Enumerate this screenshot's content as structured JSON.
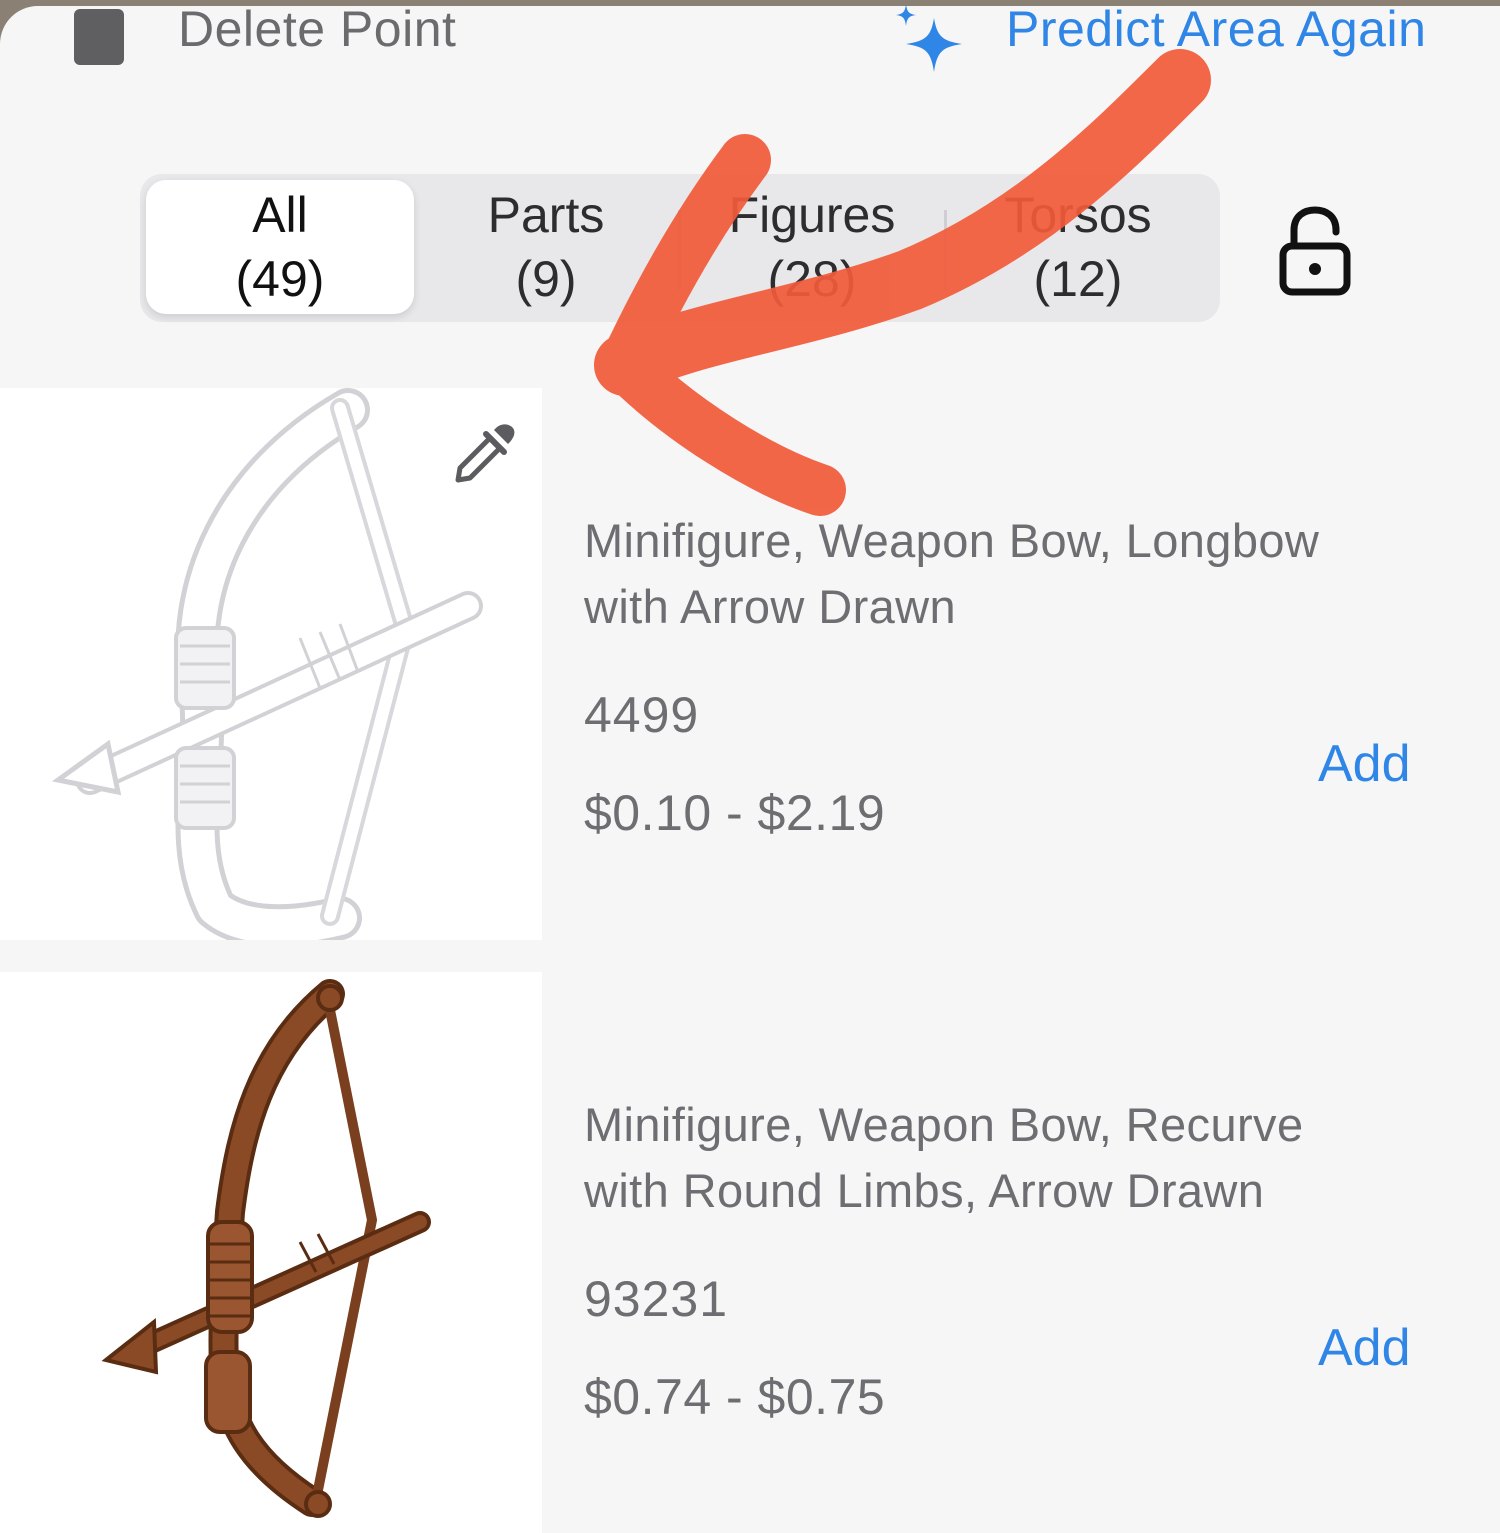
{
  "toolbar": {
    "delete_label": "Delete Point",
    "predict_label": "Predict Area Again"
  },
  "segments": [
    {
      "label": "All",
      "count": "(49)",
      "selected": true
    },
    {
      "label": "Parts",
      "count": "(9)",
      "selected": false
    },
    {
      "label": "Figures",
      "count": "(28)",
      "selected": false
    },
    {
      "label": "Torsos",
      "count": "(12)",
      "selected": false
    }
  ],
  "results": [
    {
      "title_line1": "Minifigure, Weapon Bow, Longbow",
      "title_line2": "with Arrow Drawn",
      "part_number": "4499",
      "price_range": "$0.10 - $2.19",
      "add_label": "Add",
      "image_color": "#ffffff"
    },
    {
      "title_line1": "Minifigure, Weapon Bow, Recurve",
      "title_line2": "with Round Limbs, Arrow Drawn",
      "part_number": "93231",
      "price_range": "$0.74 - $0.75",
      "add_label": "Add",
      "image_color": "#8a4a26"
    }
  ],
  "colors": {
    "accent": "#2f86e6",
    "annotation": "#f25a3a"
  }
}
